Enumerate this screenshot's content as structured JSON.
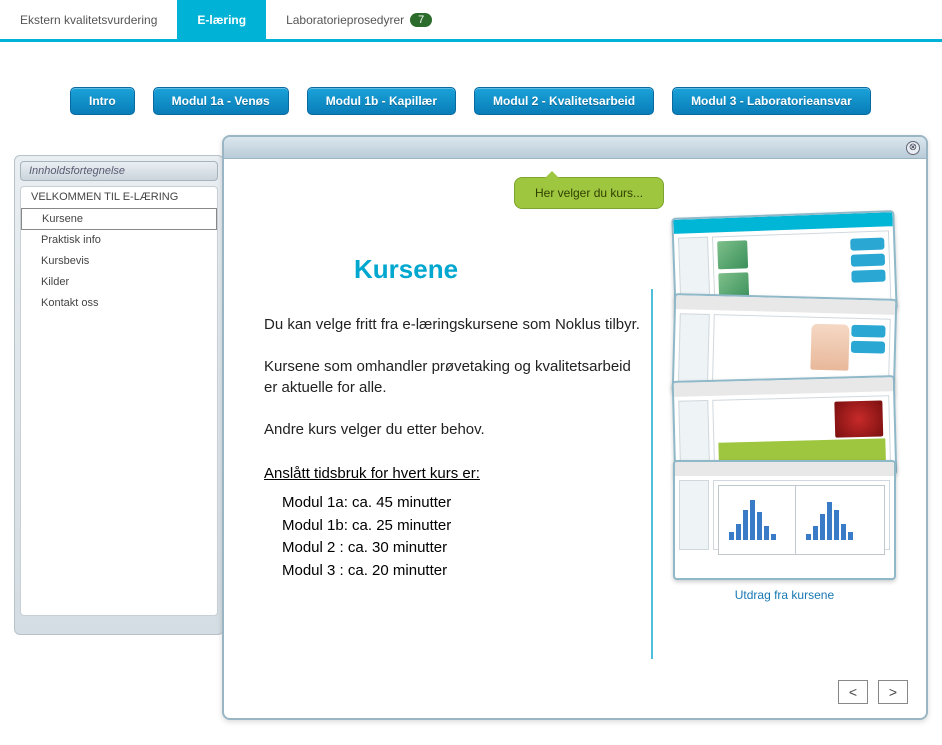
{
  "top_tabs": {
    "ekstern": "Ekstern kvalitetsvurdering",
    "elaering": "E-læring",
    "labproc": "Laboratorieprosedyrer",
    "labproc_badge": "7"
  },
  "modules": {
    "intro": "Intro",
    "m1a": "Modul 1a - Venøs",
    "m1b": "Modul 1b - Kapillær",
    "m2": "Modul 2 - Kvalitetsarbeid",
    "m3": "Modul 3 - Laboratorieansvar"
  },
  "sidebar": {
    "title": "Innholdsfortegnelse",
    "items": [
      "VELKOMMEN TIL E-LÆRING",
      "Kursene",
      "Praktisk info",
      "Kursbevis",
      "Kilder",
      "Kontakt oss"
    ]
  },
  "callout": "Her velger du kurs...",
  "content": {
    "heading": "Kursene",
    "p1": "Du kan velge fritt fra e-læringskursene som Noklus tilbyr.",
    "p2": "Kursene som omhandler prøvetaking og kvalitetsarbeid er aktuelle for alle.",
    "p3": "Andre kurs velger du etter behov.",
    "time_head": "Anslått tidsbruk for hvert kurs er:",
    "t1": "Modul 1a: ca. 45 minutter",
    "t2": "Modul 1b: ca. 25 minutter",
    "t3": "Modul 2  : ca. 30 minutter",
    "t4": "Modul 3  : ca. 20 minutter",
    "thumb_caption": "Utdrag fra kursene"
  },
  "pager": {
    "prev": "<",
    "next": ">"
  }
}
